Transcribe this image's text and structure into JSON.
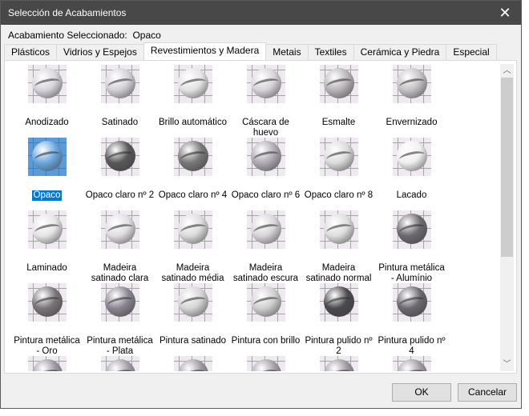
{
  "window": {
    "title": "Selección de Acabamientos"
  },
  "selection": {
    "label": "Acabamiento Seleccionado:",
    "value": "Opaco"
  },
  "tabs": [
    {
      "label": "Plásticos"
    },
    {
      "label": "Vidrios y Espejos"
    },
    {
      "label": "Revestimientos y Madera",
      "active": true
    },
    {
      "label": "Metais"
    },
    {
      "label": "Textiles"
    },
    {
      "label": "Cerámica y Piedra"
    },
    {
      "label": "Especial"
    }
  ],
  "items": [
    {
      "label": "Anodizado",
      "tone": "#d8d4dc"
    },
    {
      "label": "Satinado",
      "tone": "#d4d0d8"
    },
    {
      "label": "Brillo automático",
      "tone": "#e4e4e4"
    },
    {
      "label": "Cáscara de huevo",
      "tone": "#d8d2da"
    },
    {
      "label": "Esmalte",
      "tone": "#b8b4b8"
    },
    {
      "label": "Envernizado",
      "tone": "#c4c2c4"
    },
    {
      "label": "Opaco",
      "tone": "#6aa8e0",
      "selected": true
    },
    {
      "label": "Opaco claro nº 2",
      "tone": "#585858"
    },
    {
      "label": "Opaco claro nº 4",
      "tone": "#787878"
    },
    {
      "label": "Opaco claro nº 6",
      "tone": "#b0aab4"
    },
    {
      "label": "Opaco claro nº 8",
      "tone": "#dcdcdc"
    },
    {
      "label": "Lacado",
      "tone": "#f0f0f0"
    },
    {
      "label": "Laminado",
      "tone": "#e6e6e6"
    },
    {
      "label": "Madeira satinado clara",
      "tone": "#e0dee2"
    },
    {
      "label": "Madeira satinado média",
      "tone": "#dcdcdc"
    },
    {
      "label": "Madeira satinado escura",
      "tone": "#d8d6da"
    },
    {
      "label": "Madeira satinado normal",
      "tone": "#dedede"
    },
    {
      "label": "Pintura metálica - Alumínio",
      "tone": "#6e6a70"
    },
    {
      "label": "Pintura metálica - Oro",
      "tone": "#7a7478"
    },
    {
      "label": "Pintura metálica - Plata",
      "tone": "#8a8490"
    },
    {
      "label": "Pintura satinado",
      "tone": "#d4d4d4"
    },
    {
      "label": "Pintura con brillo",
      "tone": "#cfcfcf"
    },
    {
      "label": "Pintura pulido nº 2",
      "tone": "#4a4a4e"
    },
    {
      "label": "Pintura pulido nº 4",
      "tone": "#6c6870"
    },
    {
      "label": "",
      "tone": "#9a96a0"
    },
    {
      "label": "",
      "tone": "#a09ca4"
    },
    {
      "label": "",
      "tone": "#9c98a0"
    },
    {
      "label": "",
      "tone": "#a29ea6"
    },
    {
      "label": "",
      "tone": "#9a96a0"
    },
    {
      "label": "",
      "tone": "#9e9aa2"
    }
  ],
  "buttons": {
    "ok": "OK",
    "cancel": "Cancelar"
  },
  "scroll": {
    "position_fraction": 0.0,
    "visible_fraction": 0.64
  }
}
